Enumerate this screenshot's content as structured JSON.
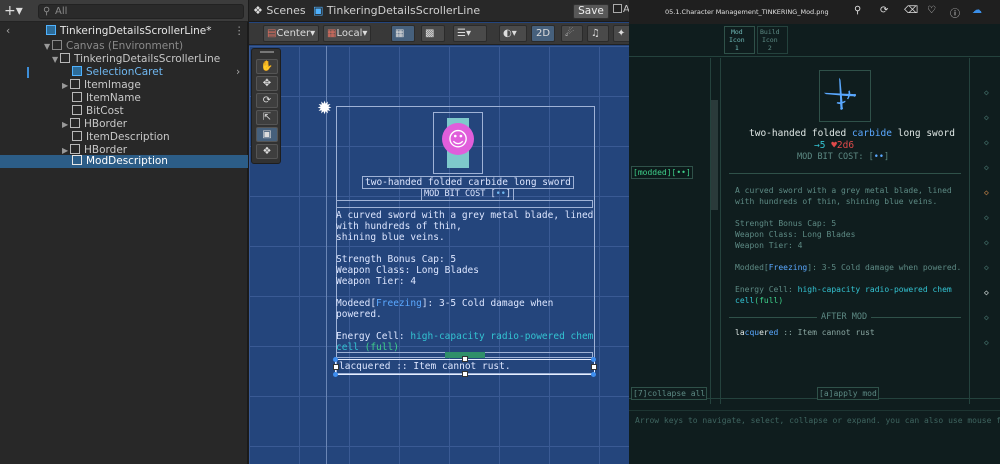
{
  "hierarchy": {
    "add_label": "+▾",
    "search_placeholder": "All",
    "scene_name": "TinkeringDetailsScrollerLine*",
    "items": [
      {
        "label": "Canvas (Environment)"
      },
      {
        "label": "TinkeringDetailsScrollerLine"
      },
      {
        "label": "SelectionCaret"
      },
      {
        "label": "ItemImage"
      },
      {
        "label": "ItemName"
      },
      {
        "label": "BitCost"
      },
      {
        "label": "HBorder"
      },
      {
        "label": "ItemDescription"
      },
      {
        "label": "HBorder"
      },
      {
        "label": "ModDescription"
      }
    ]
  },
  "scene": {
    "tab_scenes": "Scenes",
    "tab_prefab": "TinkeringDetailsScrollerLine",
    "save_label": "Save",
    "auto_label": "A",
    "pivot_label": "Center",
    "space_label": "Local",
    "mode_2d": "2D",
    "preview": {
      "item_name": "two-handed folded carbide long sword",
      "bit_cost": "MOD BIT COST [",
      "bit_glyph": "••",
      "bit_close": "]",
      "desc_line1": "A curved sword with a grey metal blade, lined",
      "desc_line2": "with hundreds of thin,",
      "desc_line3": "shining blue veins.",
      "stat1": "Strength Bonus Cap: 5",
      "stat2": "Weapon Class: Long Blades",
      "stat3": "Weapon Tier: 4",
      "mod_a": "Modeed[",
      "mod_name": "Freezing",
      "mod_b": "]: 3-5 Cold damage when",
      "mod_c": "powered.",
      "cell_a": "Energy Cell: ",
      "cell_name": "high-capacity radio-powered chem",
      "cell_b": "cell ",
      "cell_full": "(full)",
      "after": "lacquered :: Item cannot rust."
    }
  },
  "viewer": {
    "title": "05.1.Character Management_TINKERING_Mod.png",
    "tab1": "Mod\nIcon\n1",
    "tab2": "Build\nIcon\n2",
    "item_prefix": "two-handed folded ",
    "item_material": "carbide",
    "item_suffix": " long sword",
    "pv": "→5",
    "dmg": "♥2d6",
    "bit_cost": "MOD BIT COST: [",
    "bit_glyph": "••",
    "bit_close": "]",
    "modded_tag": "[modded][••]",
    "desc1": "A curved sword with a grey metal blade, lined",
    "desc2": "with hundreds of thin, shining blue veins.",
    "stat1": "Strenght Bonus Cap: 5",
    "stat2": "Weapon Class: Long Blades",
    "stat3": "Weapon Tier: 4",
    "mod_a": "Modded[",
    "mod_name": "Freezing",
    "mod_b": "]: 3-5 Cold damage when powered.",
    "cell_a": "Energy Cell: ",
    "cell_b": "high-capacity radio-powered chem",
    "cell_c": "cell",
    "cell_full": "(full)",
    "after_header": "AFTER MOD",
    "after_a": "la",
    "after_b": "cqu",
    "after_c": "er",
    "after_d": "ed",
    "after_e": " :: Item cannot rust",
    "collapse": "[7]collapse all",
    "apply": "[a]apply mod",
    "hint": "Arrow keys to navigate, select, collapse or expand. you can also use mouse for"
  }
}
